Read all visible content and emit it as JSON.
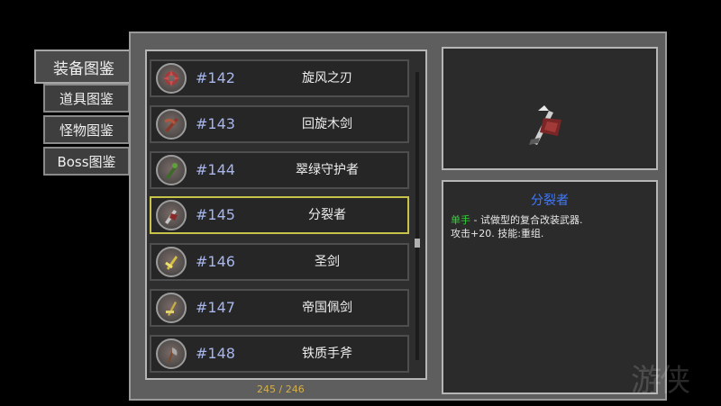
{
  "tabs": [
    {
      "label": "装备图鉴",
      "active": true
    },
    {
      "label": "道具图鉴",
      "active": false
    },
    {
      "label": "怪物图鉴",
      "active": false
    },
    {
      "label": "Boss图鉴",
      "active": false
    }
  ],
  "list": {
    "items": [
      {
        "number": "#142",
        "name": "旋风之刃",
        "icon": "spinning-blade-icon",
        "selected": false
      },
      {
        "number": "#143",
        "name": "回旋木剑",
        "icon": "wooden-boomerang-sword-icon",
        "selected": false
      },
      {
        "number": "#144",
        "name": "翠绿守护者",
        "icon": "green-guardian-icon",
        "selected": false
      },
      {
        "number": "#145",
        "name": "分裂者",
        "icon": "splitter-weapon-icon",
        "selected": true
      },
      {
        "number": "#146",
        "name": "圣剑",
        "icon": "holy-sword-icon",
        "selected": false
      },
      {
        "number": "#147",
        "name": "帝国佩剑",
        "icon": "imperial-sabre-icon",
        "selected": false
      },
      {
        "number": "#148",
        "name": "铁质手斧",
        "icon": "iron-hand-axe-icon",
        "selected": false
      }
    ],
    "counter": "245 / 246"
  },
  "detail": {
    "preview_icon": "splitter-weapon-icon",
    "title": "分裂者",
    "hand_tag": "单手",
    "line1_rest": " - 试做型的复合改装武器.",
    "line2": "攻击+20. 技能:重组."
  },
  "colors": {
    "number": "#a8b6ec",
    "title": "#3f7aff",
    "hand_tag": "#35d23a",
    "selected_border": "#c7c34a",
    "counter": "#d4b04a"
  },
  "watermark": "游侠"
}
